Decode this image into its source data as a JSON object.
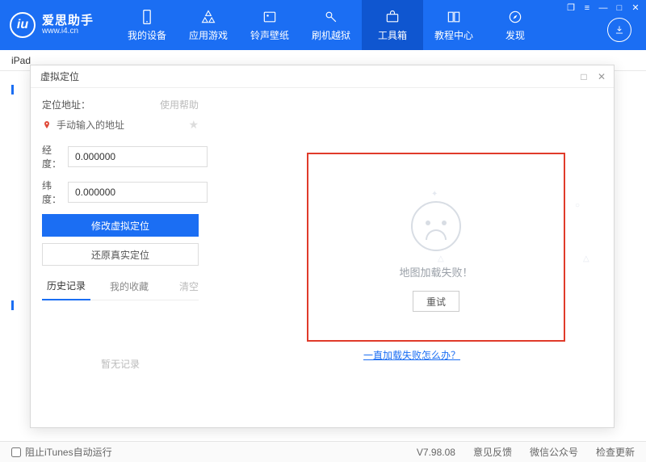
{
  "brand": {
    "name": "爱思助手",
    "url": "www.i4.cn"
  },
  "nav": {
    "items": [
      {
        "label": "我的设备"
      },
      {
        "label": "应用游戏"
      },
      {
        "label": "铃声壁纸"
      },
      {
        "label": "刷机越狱"
      },
      {
        "label": "工具箱"
      },
      {
        "label": "教程中心"
      },
      {
        "label": "发现"
      }
    ],
    "active_index": 4
  },
  "subbar": {
    "device": "iPad"
  },
  "dialog": {
    "title": "虚拟定位",
    "left": {
      "addr_label": "定位地址：",
      "help": "使用帮助",
      "manual_addr": "手动输入的地址",
      "lng_label": "经度：",
      "lng_value": "0.000000",
      "lat_label": "纬度：",
      "lat_value": "0.000000",
      "btn_modify": "修改虚拟定位",
      "btn_restore": "还原真实定位",
      "tab_history": "历史记录",
      "tab_fav": "我的收藏",
      "clear": "清空",
      "empty": "暂无记录"
    },
    "right": {
      "fail_text": "地图加载失败！",
      "retry": "重试",
      "fail_link": "一直加载失败怎么办？"
    }
  },
  "status": {
    "block_itunes": "阻止iTunes自动运行",
    "version": "V7.98.08",
    "feedback": "意见反馈",
    "wechat": "微信公众号",
    "update": "检查更新"
  }
}
